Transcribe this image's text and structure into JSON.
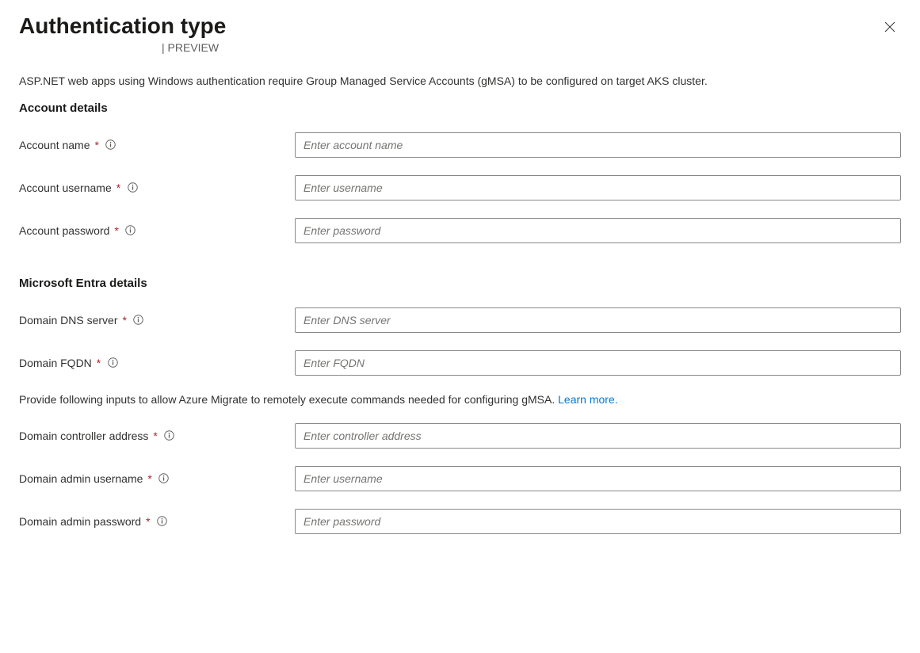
{
  "header": {
    "title": "Authentication type",
    "preview_separator": "| ",
    "preview_label": "PREVIEW"
  },
  "intro": "ASP.NET web apps using Windows authentication require Group Managed Service Accounts (gMSA) to be configured on target AKS cluster.",
  "sections": {
    "account": {
      "heading": "Account details",
      "fields": {
        "name": {
          "label": "Account name",
          "placeholder": "Enter account name"
        },
        "username": {
          "label": "Account username",
          "placeholder": "Enter username"
        },
        "password": {
          "label": "Account password",
          "placeholder": "Enter password"
        }
      }
    },
    "entra": {
      "heading": "Microsoft Entra details",
      "fields": {
        "dns": {
          "label": "Domain DNS server",
          "placeholder": "Enter DNS server"
        },
        "fqdn": {
          "label": "Domain FQDN",
          "placeholder": "Enter FQDN"
        }
      },
      "hint_prefix": "Provide following inputs to allow Azure Migrate to remotely execute commands needed for configuring gMSA. ",
      "hint_link": "Learn more.",
      "fields2": {
        "ctrl": {
          "label": "Domain controller address",
          "placeholder": "Enter controller address"
        },
        "adminu": {
          "label": "Domain admin username",
          "placeholder": "Enter username"
        },
        "adminp": {
          "label": "Domain admin password",
          "placeholder": "Enter password"
        }
      }
    }
  },
  "required_mark": "*"
}
